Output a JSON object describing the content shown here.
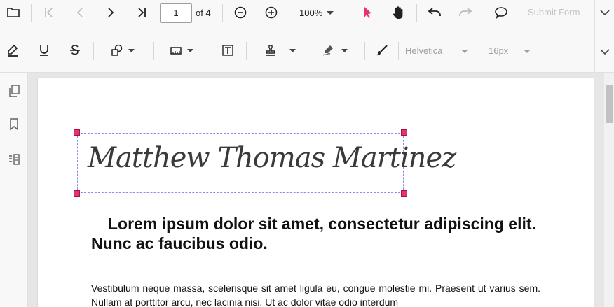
{
  "toolbar_primary": {
    "page_number": "1",
    "page_total_label": "of 4",
    "zoom_label": "100%",
    "submit_form_label": "Submit Form"
  },
  "toolbar_annotation": {
    "font_family_value": "Helvetica",
    "font_size_value": "16px"
  },
  "icons": {
    "open": "folder-icon",
    "first_page": "first-page-icon",
    "previous_page": "previous-page-icon",
    "next_page": "next-page-icon",
    "last_page": "last-page-icon",
    "zoom_out": "zoom-out-icon",
    "zoom_in": "zoom-in-icon",
    "select": "pointer-icon",
    "pan": "hand-icon",
    "undo": "undo-icon",
    "redo": "redo-icon",
    "comment": "comment-icon",
    "highlight": "highlighter-icon",
    "underline": "underline-icon",
    "strikethrough": "strikethrough-icon",
    "shapes": "shapes-icon",
    "measure": "ruler-icon",
    "free_text": "text-box-icon",
    "stamp": "stamp-icon",
    "signature": "signature-icon",
    "ink": "ink-icon",
    "sidebar_pages": "page-thumbnails-icon",
    "sidebar_bookmarks": "bookmark-icon",
    "sidebar_fields": "form-fields-icon"
  },
  "colors": {
    "accent": "#e8336a",
    "selection_border": "#8c8cf0"
  },
  "document": {
    "signature_text": "Matthew Thomas Martinez",
    "heading": "Lorem ipsum dolor sit amet, consectetur adipiscing elit. Nunc ac faucibus odio.",
    "paragraph": "Vestibulum neque massa, scelerisque sit amet ligula eu, congue molestie mi. Praesent ut varius sem. Nullam at porttitor arcu, nec lacinia nisi. Ut ac dolor vitae odio interdum"
  }
}
